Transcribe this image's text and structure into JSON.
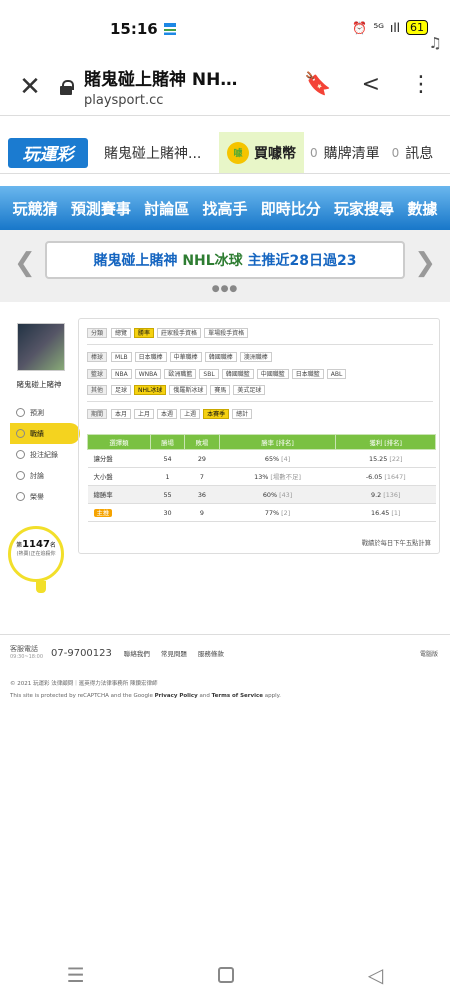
{
  "status": {
    "time": "15:16",
    "music": "♫",
    "alarm": "⏰",
    "net": "⁵ᴳ",
    "signal": "ıll",
    "battery": "61"
  },
  "browser": {
    "close": "✕",
    "title": "賭鬼碰上賭神 NH…",
    "url": "playsport.cc",
    "bookmark": "🔖",
    "share": "<",
    "menu": "⋮"
  },
  "site": {
    "logo": "玩運彩",
    "top_name": "賭鬼碰上賭神...",
    "buy_coin": "買噱幣",
    "coin_icon": "噱",
    "cart_count": "0",
    "cart": "購牌清單",
    "msg_count": "0",
    "msg": "訊息"
  },
  "nav": [
    "玩競猜",
    "預測賽事",
    "討論區",
    "找高手",
    "即時比分",
    "玩家搜尋",
    "數據"
  ],
  "banner": {
    "name": "賭鬼碰上賭神",
    "sport": "NHL冰球",
    "text": "主推近28日過23",
    "dots": "●●●"
  },
  "user": {
    "name": "賭鬼碰上賭神",
    "menu": [
      "預測",
      "戰績",
      "投注紀錄",
      "討論",
      "榮譽"
    ],
    "rank_prefix": "第",
    "rank": "1147",
    "rank_suffix": "名",
    "rank_note": "(熱賣)正在追殺你"
  },
  "filters": {
    "category": {
      "label": "分類",
      "chips": [
        "總覽",
        "勝率",
        "莊家殺手資格",
        "單場殺手資格"
      ]
    },
    "baseball": {
      "label": "棒球",
      "chips": [
        "MLB",
        "日本職棒",
        "中華職棒",
        "韓國職棒",
        "澳洲職棒"
      ]
    },
    "basketball": {
      "label": "籃球",
      "chips": [
        "NBA",
        "WNBA",
        "歐洲職籃",
        "SBL",
        "韓國職籃",
        "中國職籃",
        "日本職籃",
        "ABL"
      ]
    },
    "other": {
      "label": "其他",
      "chips": [
        "足球",
        "NHL冰球",
        "俄羅斯冰球",
        "賽馬",
        "美式足球"
      ]
    },
    "period": {
      "label": "期間",
      "chips": [
        "本月",
        "上月",
        "本週",
        "上週",
        "本賽季",
        "總計"
      ]
    }
  },
  "table": {
    "headers": [
      "選擇類",
      "勝場",
      "敗場",
      "勝率 [排名]",
      "獲利 [排名]"
    ],
    "rows": [
      {
        "type": "讓分盤",
        "win": "54",
        "lose": "29",
        "rate": "65%",
        "rate_rank": "[4]",
        "profit": "15.25",
        "profit_rank": "[22]"
      },
      {
        "type": "大小盤",
        "win": "1",
        "lose": "7",
        "rate": "13%",
        "rate_rank": "[場數不足]",
        "profit": "-6.05",
        "profit_rank": "[1647]"
      },
      {
        "type": "總勝率",
        "win": "55",
        "lose": "36",
        "rate": "60%",
        "rate_rank": "[43]",
        "profit": "9.2",
        "profit_rank": "[136]"
      },
      {
        "type": "主推",
        "win": "30",
        "lose": "9",
        "rate": "77%",
        "rate_rank": "[2]",
        "profit": "16.45",
        "profit_rank": "[1]"
      }
    ],
    "note": "戰績於每日下午五點計算"
  },
  "footer": {
    "service": "客服電話",
    "hours": "09:30~18:00",
    "phone": "07-9700123",
    "links": [
      "聯絡我們",
      "常見問題",
      "服務條款"
    ],
    "version": "電腦版",
    "copyright": "© 2021 玩運彩 法律顧問｜滙英得力法律事務所 陳鑽宏律師",
    "recaptcha_a": "This site is protected by reCAPTCHA and the Google",
    "privacy": "Privacy Policy",
    "and": "and",
    "terms": "Terms of Service",
    "apply": "apply."
  }
}
